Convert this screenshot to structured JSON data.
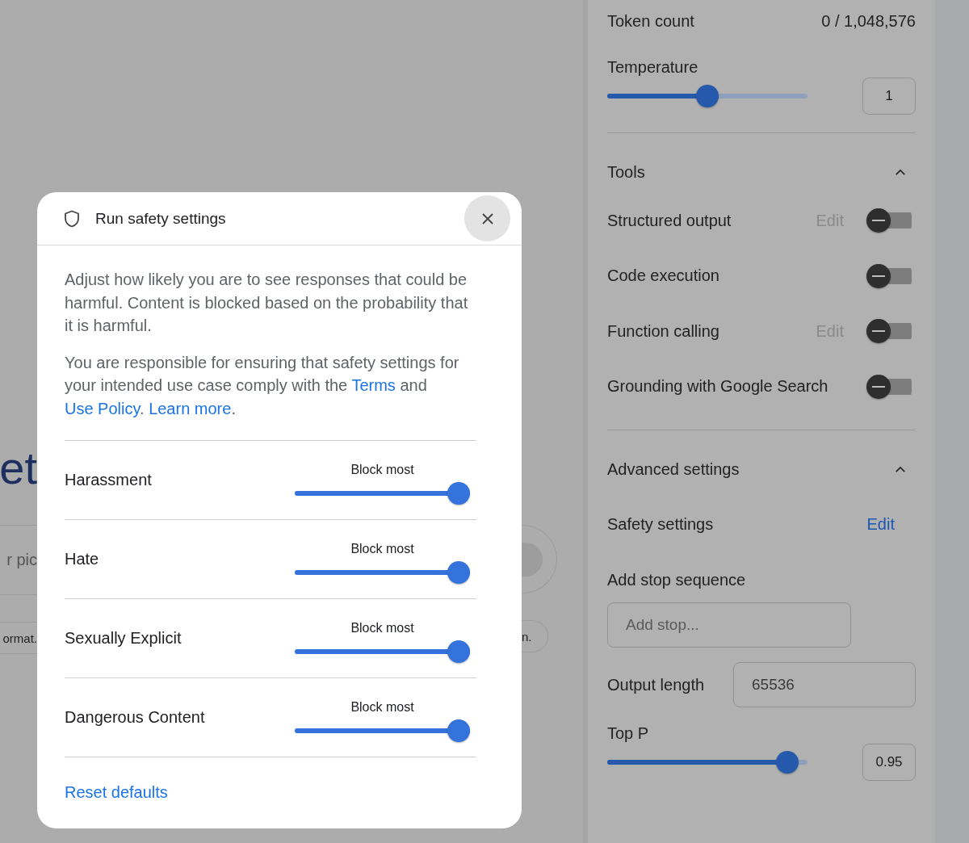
{
  "background": {
    "heading": "et",
    "prompt_fragment": "r pic",
    "left_chip": "ormat.",
    "right_chip": "n."
  },
  "dialog": {
    "title": "Run safety settings",
    "description": "Adjust how likely you are to see responses that could be harmful. Content is blocked based on the probability that it is harmful.",
    "notice": [
      {
        "kind": "text",
        "text": "You are responsible for ensuring that safety settings for your intended use case comply with the "
      },
      {
        "kind": "link",
        "text": "Terms"
      },
      {
        "kind": "text",
        "text": " and "
      },
      {
        "kind": "link",
        "text": "Use Policy"
      },
      {
        "kind": "text",
        "text": ". "
      },
      {
        "kind": "link",
        "text": "Learn more"
      },
      {
        "kind": "text",
        "text": "."
      }
    ],
    "categories": [
      {
        "name": "Harassment",
        "setting": "Block most",
        "level": 1
      },
      {
        "name": "Hate",
        "setting": "Block most",
        "level": 1
      },
      {
        "name": "Sexually Explicit",
        "setting": "Block most",
        "level": 1
      },
      {
        "name": "Dangerous Content",
        "setting": "Block most",
        "level": 1
      }
    ],
    "reset": "Reset defaults"
  },
  "panel": {
    "token_count": {
      "label": "Token count",
      "value": "0 / 1,048,576"
    },
    "temperature": {
      "label": "Temperature",
      "level": 0.5,
      "value": "1"
    },
    "tools": {
      "title": "Tools",
      "expanded": true,
      "items": [
        {
          "label": "Structured output",
          "edit": {
            "label": "Edit",
            "disabled": true
          },
          "on": false
        },
        {
          "label": "Code execution",
          "on": false
        },
        {
          "label": "Function calling",
          "edit": {
            "label": "Edit",
            "disabled": true
          },
          "on": false
        },
        {
          "label": "Grounding with Google Search",
          "on": false
        }
      ]
    },
    "advanced": {
      "title": "Advanced settings",
      "expanded": true,
      "safety": {
        "label": "Safety settings",
        "edit": {
          "label": "Edit",
          "disabled": false
        }
      },
      "stop_sequence": {
        "label": "Add stop sequence",
        "placeholder": "Add stop..."
      },
      "output_length": {
        "label": "Output length",
        "value": "65536"
      },
      "top_p": {
        "label": "Top P",
        "level": 0.95,
        "value": "0.95"
      }
    }
  }
}
